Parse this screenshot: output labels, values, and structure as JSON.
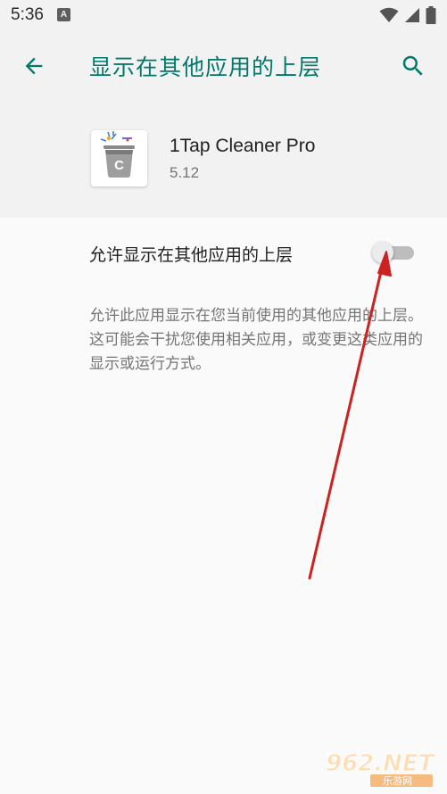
{
  "status_bar": {
    "time": "5:36",
    "notification_glyph": "A",
    "icons": [
      "wifi-icon",
      "signal-icon",
      "battery-icon"
    ]
  },
  "app_bar": {
    "title": "显示在其他应用的上层",
    "back_icon": "arrow-back-icon",
    "search_icon": "search-icon"
  },
  "app_info": {
    "name": "1Tap Cleaner Pro",
    "version": "5.12",
    "icon": "trash-can-c-icon"
  },
  "setting": {
    "label": "允许显示在其他应用的上层",
    "enabled": false
  },
  "description": "允许此应用显示在您当前使用的其他应用的上层。这可能会干扰您使用相关应用，或变更这类应用的显示或运行方式。",
  "watermark": {
    "text_main": "962.NET",
    "text_sub": "乐游网"
  },
  "colors": {
    "accent": "#00796b",
    "annotation_arrow": "#cc2222",
    "background": "#fafafa",
    "header_background": "#f2f2f2"
  }
}
